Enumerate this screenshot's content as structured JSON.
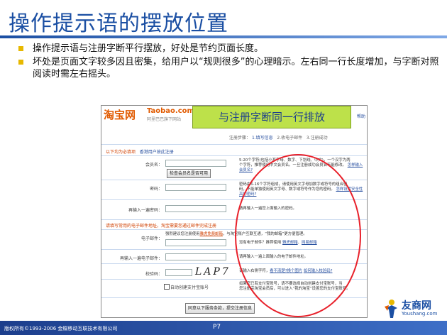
{
  "slide": {
    "title": "操作提示语的摆放位置",
    "bullets": [
      "操作提示语与注册字断平行摆放，好处是节约页面长度。",
      "坏处是页面文字较多因且密集，给用户以“规则很多”的心理暗示。左右同一行长度增加，与字断对照阅读时需左右摇头。"
    ],
    "footer_copyright": "版权所有©1993-2006 金蝶移动互联技术有限公司",
    "page_number": "P7",
    "brand_name": "友商网",
    "brand_url": "Youshang.com"
  },
  "screenshot": {
    "logo_text": "淘宝网",
    "logo_url": "Taobao.com",
    "logo_sub": "阿里巴巴旗下网站",
    "callout": "与注册字断同一行排放",
    "help_link": "帮助",
    "steps": {
      "prefix": "注册步骤：",
      "step1": "1.填写信息",
      "step2": "2.收电子邮件",
      "step3": "3.注册成功"
    },
    "section1_title": "以下均为必填项",
    "section1_link": "香港用户按此注册",
    "fields": {
      "username_label": "会员名：",
      "check_button": "检查会员名是否可用",
      "username_hint_a": "5-20个字符(包括小写字母、数字、下划线、中文)，一个汉字为两",
      "username_hint_b": "个字符，推荐使用中文会员名。一旦注册成功会员名不能修改。",
      "username_hint_link": "怎样输入会员名?",
      "password_label": "密码：",
      "password_hint_a": "密码由6-16个字符组成，请使用英文字母加数字或符号的组合密",
      "password_hint_b": "码，不能单独使用英文字母、数字或符号作为您的密码。",
      "password_hint_link": "怎样设置安全性高的密码?",
      "confirm_label": "再输入一遍密码：",
      "confirm_hint": "请再输入一遍您上面输入的密码。"
    },
    "section2_title": "请填写常用的电子邮件地址，淘宝需要您通过邮件完成注册",
    "email": {
      "label": "电子邮件：",
      "tip_prefix": "强烈建议您注册使用",
      "tip_link": "雅虎免费邮箱",
      "tip_suffix": "，与淘宝账户互联互通，“我的邮箱”更方便管理。",
      "hint_a": "没有电子邮件？推荐使用",
      "hint_link1": "雅虎邮箱",
      "hint_link2": "网易邮箱",
      "confirm_label": "再输入一遍电子邮件：",
      "confirm_hint": "请再输入一遍上面输入的电子邮件地址。"
    },
    "verify": {
      "label": "校验码：",
      "captcha": "LAP7",
      "hint_prefix": "请输入右侧字符，",
      "hint_link1": "看不清楚?换个图片",
      "hint_link2": "如何输入校验码?"
    },
    "alipay": {
      "checkbox_label": "自动创建支付宝账号",
      "hint_a": "如果您已有支付宝账号，请不要选择自动创建支付宝账号，当",
      "hint_b": "您注册完淘宝会员后，可以进入“我的淘宝”设置您的支付宝账号。"
    },
    "submit_button": "同意以下服务条款，提交注册信息"
  }
}
